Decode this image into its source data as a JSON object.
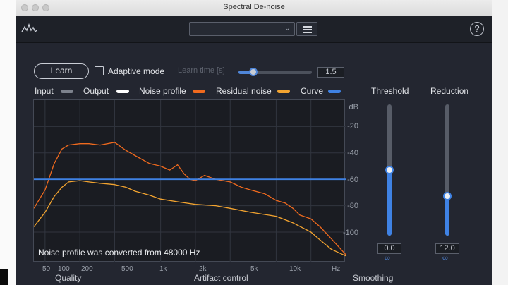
{
  "window": {
    "title": "Spectral De-noise"
  },
  "toolbar": {
    "preset_value": "",
    "help_glyph": "?"
  },
  "controls": {
    "learn_label": "Learn",
    "adaptive_label": "Adaptive mode",
    "learn_time_label": "Learn time [s]",
    "learn_time_value": "1.5",
    "learn_time_fraction": 0.2
  },
  "legend": [
    {
      "label": "Input",
      "color": "#7d828d"
    },
    {
      "label": "Output",
      "color": "#ffffff"
    },
    {
      "label": "Noise profile",
      "color": "#f06a1e"
    },
    {
      "label": "Residual noise",
      "color": "#f3a430"
    },
    {
      "label": "Curve",
      "color": "#3f82e4"
    }
  ],
  "graph": {
    "db_unit": "dB",
    "db_ticks": [
      "-20",
      "-40",
      "-60",
      "-80",
      "-100"
    ],
    "freq_ticks": [
      "50",
      "100",
      "200",
      "500",
      "1k",
      "2k",
      "5k",
      "10k",
      "Hz"
    ],
    "note": "Noise profile was converted from 48000 Hz"
  },
  "chart_data": {
    "type": "line",
    "xlabel": "Hz",
    "ylabel": "dB",
    "x_scale": "log",
    "xlim": [
      40,
      20000
    ],
    "ylim": [
      -123,
      0
    ],
    "grid": true,
    "series": [
      {
        "name": "Noise profile",
        "color": "#f06a1e",
        "x": [
          40,
          50,
          60,
          70,
          80,
          100,
          120,
          150,
          200,
          250,
          300,
          400,
          500,
          600,
          700,
          800,
          900,
          1000,
          1200,
          1500,
          2000,
          2500,
          3000,
          4000,
          5000,
          6000,
          7000,
          8000,
          10000,
          12000,
          15000,
          20000
        ],
        "y": [
          -82,
          -68,
          -48,
          -37,
          -34,
          -33,
          -33,
          -34,
          -32,
          -38,
          -42,
          -48,
          -50,
          -53,
          -49,
          -56,
          -60,
          -61,
          -57,
          -60,
          -62,
          -66,
          -68,
          -71,
          -76,
          -78,
          -82,
          -87,
          -90,
          -96,
          -105,
          -117
        ]
      },
      {
        "name": "Residual noise",
        "color": "#f3a430",
        "x": [
          40,
          50,
          60,
          70,
          80,
          100,
          120,
          150,
          200,
          250,
          300,
          400,
          500,
          700,
          1000,
          1500,
          2000,
          3000,
          5000,
          7000,
          10000,
          12000,
          15000,
          20000
        ],
        "y": [
          -96,
          -85,
          -73,
          -66,
          -62,
          -61,
          -62,
          -63,
          -64,
          -66,
          -69,
          -72,
          -75,
          -77,
          -79,
          -80,
          -82,
          -85,
          -88,
          -93,
          -100,
          -106,
          -113,
          -118
        ]
      },
      {
        "name": "Curve",
        "color": "#3f82e4",
        "x": [
          40,
          20000
        ],
        "y": [
          -60,
          -60
        ]
      }
    ]
  },
  "right": {
    "threshold_label": "Threshold",
    "threshold_value": "0.0",
    "threshold_fraction": 0.5,
    "reduction_label": "Reduction",
    "reduction_value": "12.0",
    "reduction_fraction": 0.3
  },
  "bottom": {
    "quality_label": "Quality",
    "artifact_label": "Artifact control",
    "smoothing_label": "Smoothing"
  }
}
